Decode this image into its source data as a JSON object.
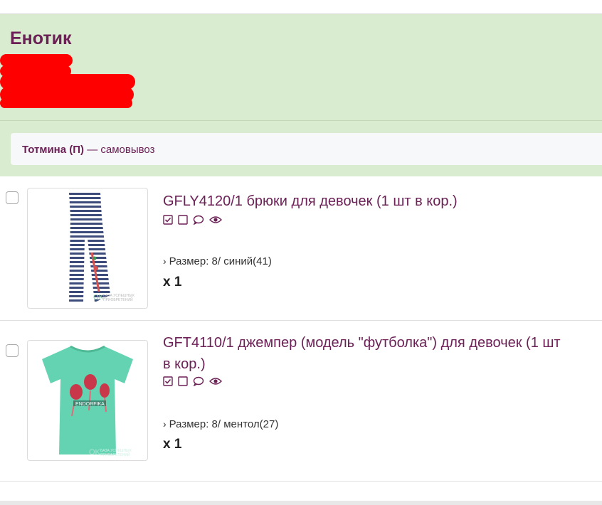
{
  "shop": {
    "name": "Енотик"
  },
  "delivery": {
    "point": "Тотмина (П)",
    "method": "— самовывоз"
  },
  "items": [
    {
      "title": "GFLY4120/1 брюки для девочек (1 шт в кор.)",
      "size_label": "Размер: 8/ синий(41)",
      "quantity": "x 1",
      "image": "striped-leggings"
    },
    {
      "title": "GFT4110/1 джемпер (модель \"футболка\") для девочек (1 шт в кор.)",
      "size_label": "Размер: 8/ ментол(27)",
      "quantity": "x 1",
      "image": "mint-tshirt"
    }
  ],
  "colors": {
    "accent": "#6c2156",
    "panel_background": "#d9eccf",
    "redaction": "#ff0000"
  },
  "icons": [
    "checked-box-icon",
    "empty-box-icon",
    "comment-icon",
    "eye-icon"
  ]
}
